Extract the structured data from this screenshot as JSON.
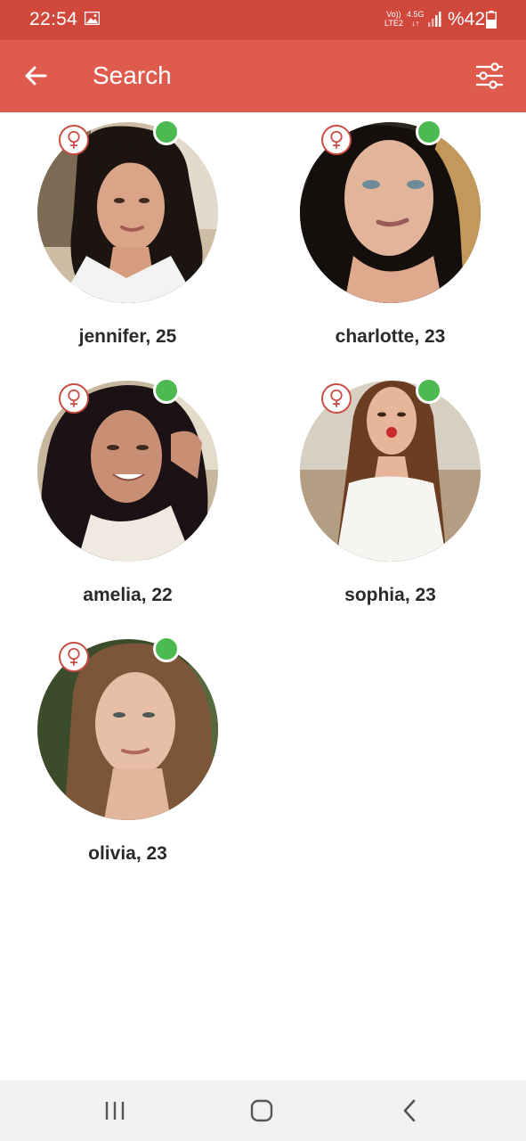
{
  "status_bar": {
    "time": "22:54",
    "net_top": "Vo))",
    "net_bottom": "LTE2",
    "g_top": "4.5G",
    "g_bottom": "↓↑",
    "battery": "%42"
  },
  "app_bar": {
    "title": "Search",
    "back_icon": "arrow-left-icon",
    "filter_icon": "sliders-icon"
  },
  "profiles": [
    {
      "name": "jennifer, 25",
      "online": true,
      "gender_icon": "female-symbol-icon"
    },
    {
      "name": "charlotte, 23",
      "online": true,
      "gender_icon": "female-symbol-icon"
    },
    {
      "name": "amelia, 22",
      "online": true,
      "gender_icon": "female-symbol-icon"
    },
    {
      "name": "sophia, 23",
      "online": true,
      "gender_icon": "female-symbol-icon"
    },
    {
      "name": "olivia, 23",
      "online": true,
      "gender_icon": "female-symbol-icon"
    }
  ],
  "colors": {
    "status_bar": "#d0483b",
    "app_bar": "#df5b4d",
    "online": "#4cba51",
    "gender_icon": "#c94d42",
    "name_text": "#2a2a2e",
    "nav_bar": "#f1f1f1"
  },
  "nav_bar": {
    "recents_icon": "recents-icon",
    "home_icon": "home-icon",
    "back_icon": "chevron-left-icon"
  }
}
